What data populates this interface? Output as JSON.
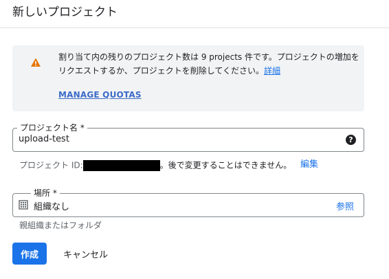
{
  "page": {
    "title": "新しいプロジェクト"
  },
  "quota_banner": {
    "icon": "warning-icon",
    "icon_color": "#e37400",
    "message": "割り当て内の残りのプロジェクト数は 9 projects 件です。プロジェクトの増加をリクエストするか、プロジェクトを削除してください。",
    "details_link": "詳細",
    "manage_quotas": "MANAGE QUOTAS"
  },
  "project_name": {
    "label": "プロジェクト名 *",
    "value": "upload-test",
    "help_icon": "help-icon"
  },
  "project_id": {
    "prefix": "プロジェクト ID:",
    "suffix": "。後で変更することはできません。",
    "edit_link": "編集"
  },
  "location": {
    "label": "場所 *",
    "value": "組織なし",
    "icon": "organization-icon",
    "browse_link": "参照",
    "hint": "親組織またはフォルダ"
  },
  "actions": {
    "create": "作成",
    "cancel": "キャンセル"
  },
  "colors": {
    "primary": "#1a73e8",
    "banner_bg": "#f1f3f4",
    "warning": "#e37400"
  }
}
